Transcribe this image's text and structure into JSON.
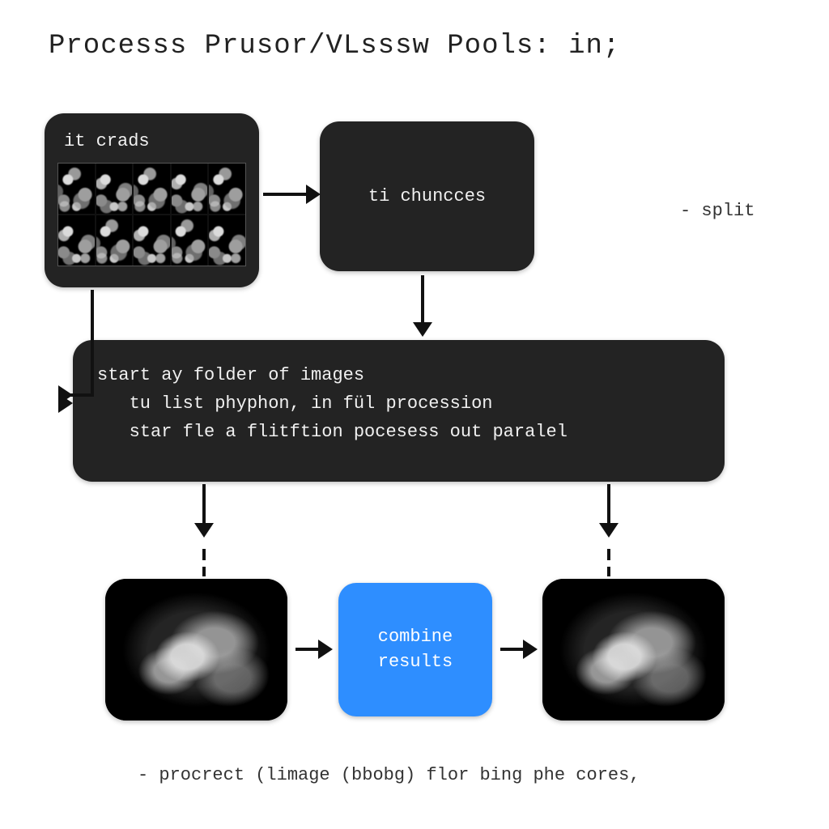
{
  "title": "Processs Prusor/VLsssw  Pools:   in;",
  "boxA": {
    "label": "it crads"
  },
  "boxB": {
    "label": "ti chuncces"
  },
  "split_label": "- split",
  "boxC": {
    "line1": "start ay folder of images",
    "line2": "   tu list phyphon, in fül procession",
    "line3": "   star fle a flitftion pocesess out paralel"
  },
  "boxE": {
    "line1": "combine",
    "line2": "results"
  },
  "caption": "- procrect (limage (bbobg) flor bing phe cores,",
  "colors": {
    "dark": "#232323",
    "blue": "#2e8eff",
    "text": "#f0f0f0"
  }
}
